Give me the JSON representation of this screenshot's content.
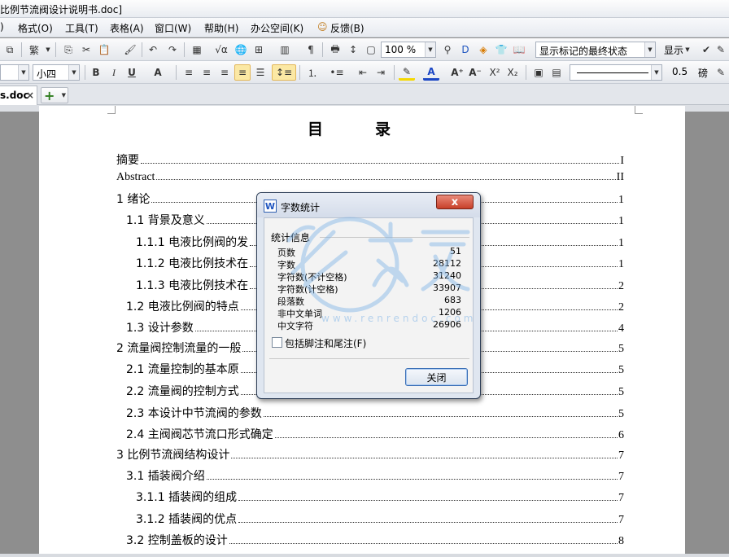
{
  "window": {
    "title": "比例节流阀设计说明书.doc]"
  },
  "menu": {
    "items": [
      ")",
      "格式(O)",
      "工具(T)",
      "表格(A)",
      "窗口(W)",
      "帮助(H)",
      "办公空间(K)",
      "反馈(B)"
    ]
  },
  "toolbar1": {
    "zoom": "100 %",
    "markup_mode": "显示标记的最终状态",
    "show_label": "显示"
  },
  "toolbar2": {
    "font_name": "",
    "font_size": "小四",
    "line_width": "0.5",
    "line_unit": "磅"
  },
  "tabs": {
    "doc_label": "s.doc",
    "close": "×",
    "add": "+"
  },
  "document": {
    "title": "目录",
    "toc": [
      {
        "label": "摘要",
        "page": "I"
      },
      {
        "label": "Abstract",
        "page": "II"
      },
      {
        "label": "1  绪论",
        "page": "1"
      },
      {
        "label": "1.1  背景及意义",
        "page": "1"
      },
      {
        "label": "1.1.1 电液比例阀的发",
        "page": "1"
      },
      {
        "label": "1.1.2 电液比例技术在",
        "page": "1"
      },
      {
        "label": "1.1.3 电液比例技术在",
        "page": "2"
      },
      {
        "label": "1.2  电液比例阀的特点",
        "page": "2"
      },
      {
        "label": "1.3  设计参数",
        "page": "4"
      },
      {
        "label": "2  流量阀控制流量的一般",
        "page": "5"
      },
      {
        "label": "2.1  流量控制的基本原",
        "page": "5"
      },
      {
        "label": "2.2  流量阀的控制方式",
        "page": "5"
      },
      {
        "label": "2.3  本设计中节流阀的参数",
        "page": "5"
      },
      {
        "label": "2.4  主阀阀芯节流口形式确定",
        "page": "6"
      },
      {
        "label": "3  比例节流阀结构设计",
        "page": "7"
      },
      {
        "label": "3.1  插装阀介绍",
        "page": "7"
      },
      {
        "label": "3.1.1    插装阀的组成",
        "page": "7"
      },
      {
        "label": "3.1.2  插装阀的优点",
        "page": "7"
      },
      {
        "label": "3.2  控制盖板的设计",
        "page": "8"
      }
    ]
  },
  "dialog": {
    "title": "字数统计",
    "close_glyph": "x",
    "group_label": "统计信息",
    "stats": [
      {
        "label": "页数",
        "value": "51"
      },
      {
        "label": "字数",
        "value": "28112"
      },
      {
        "label": "字符数(不计空格)",
        "value": "31240"
      },
      {
        "label": "字符数(计空格)",
        "value": "33907"
      },
      {
        "label": "段落数",
        "value": "683"
      },
      {
        "label": "非中文单词",
        "value": "1206"
      },
      {
        "label": "中文字符",
        "value": "26906"
      }
    ],
    "include_footnotes_label": "包括脚注和尾注(F)",
    "include_footnotes_checked": false,
    "close_button": "关闭"
  },
  "watermark": {
    "text": "人人文库",
    "url": "www.renrendoc.com"
  },
  "colors": {
    "accent": "#2f6fc0",
    "dialog_close": "#c8402a",
    "highlight": "#fbe8a4"
  }
}
